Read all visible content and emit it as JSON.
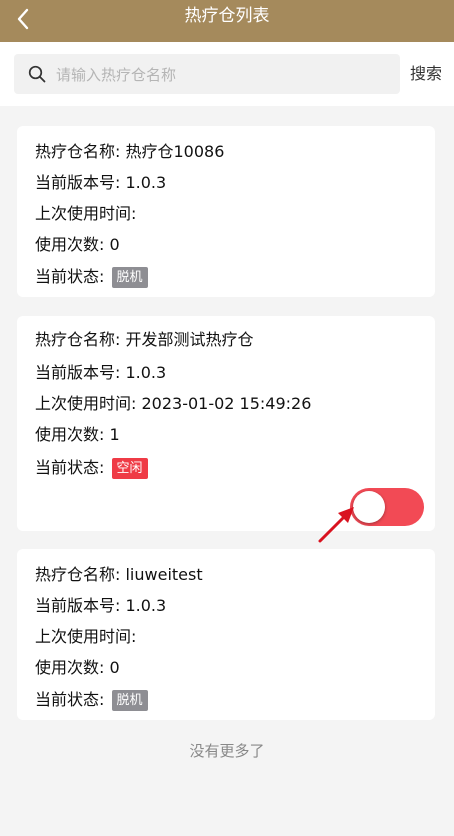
{
  "header": {
    "title": "热疗仓列表"
  },
  "search": {
    "placeholder": "请输入热疗仓名称",
    "value": "",
    "button_label": "搜索"
  },
  "cards": [
    {
      "name_label": "热疗仓名称: 热疗仓10086",
      "version_label": "当前版本号: 1.0.3",
      "last_used_label": "上次使用时间:",
      "count_label": "使用次数: 0",
      "status_label": "当前状态:",
      "status_badge": "脱机",
      "status_color": "#8e8e93"
    },
    {
      "name_label": "热疗仓名称: 开发部测试热疗仓",
      "version_label": "当前版本号: 1.0.3",
      "last_used_label": "上次使用时间: 2023-01-02 15:49:26",
      "count_label": "使用次数: 1",
      "status_label": "当前状态:",
      "status_badge": "空闲",
      "status_color": "#ef3b46",
      "toggle_on": true
    },
    {
      "name_label": "热疗仓名称: liuweitest",
      "version_label": "当前版本号: 1.0.3",
      "last_used_label": "上次使用时间:",
      "count_label": "使用次数: 0",
      "status_label": "当前状态:",
      "status_badge": "脱机",
      "status_color": "#8e8e93"
    }
  ],
  "footer": {
    "text": "没有更多了"
  },
  "colors": {
    "header_bg": "#a58a5c",
    "toggle_on": "#f24a55",
    "annotation_arrow": "#d9121f"
  },
  "icons": {
    "back": "chevron-left-icon",
    "search": "magnifier-icon",
    "annotation": "red-arrow-icon"
  }
}
